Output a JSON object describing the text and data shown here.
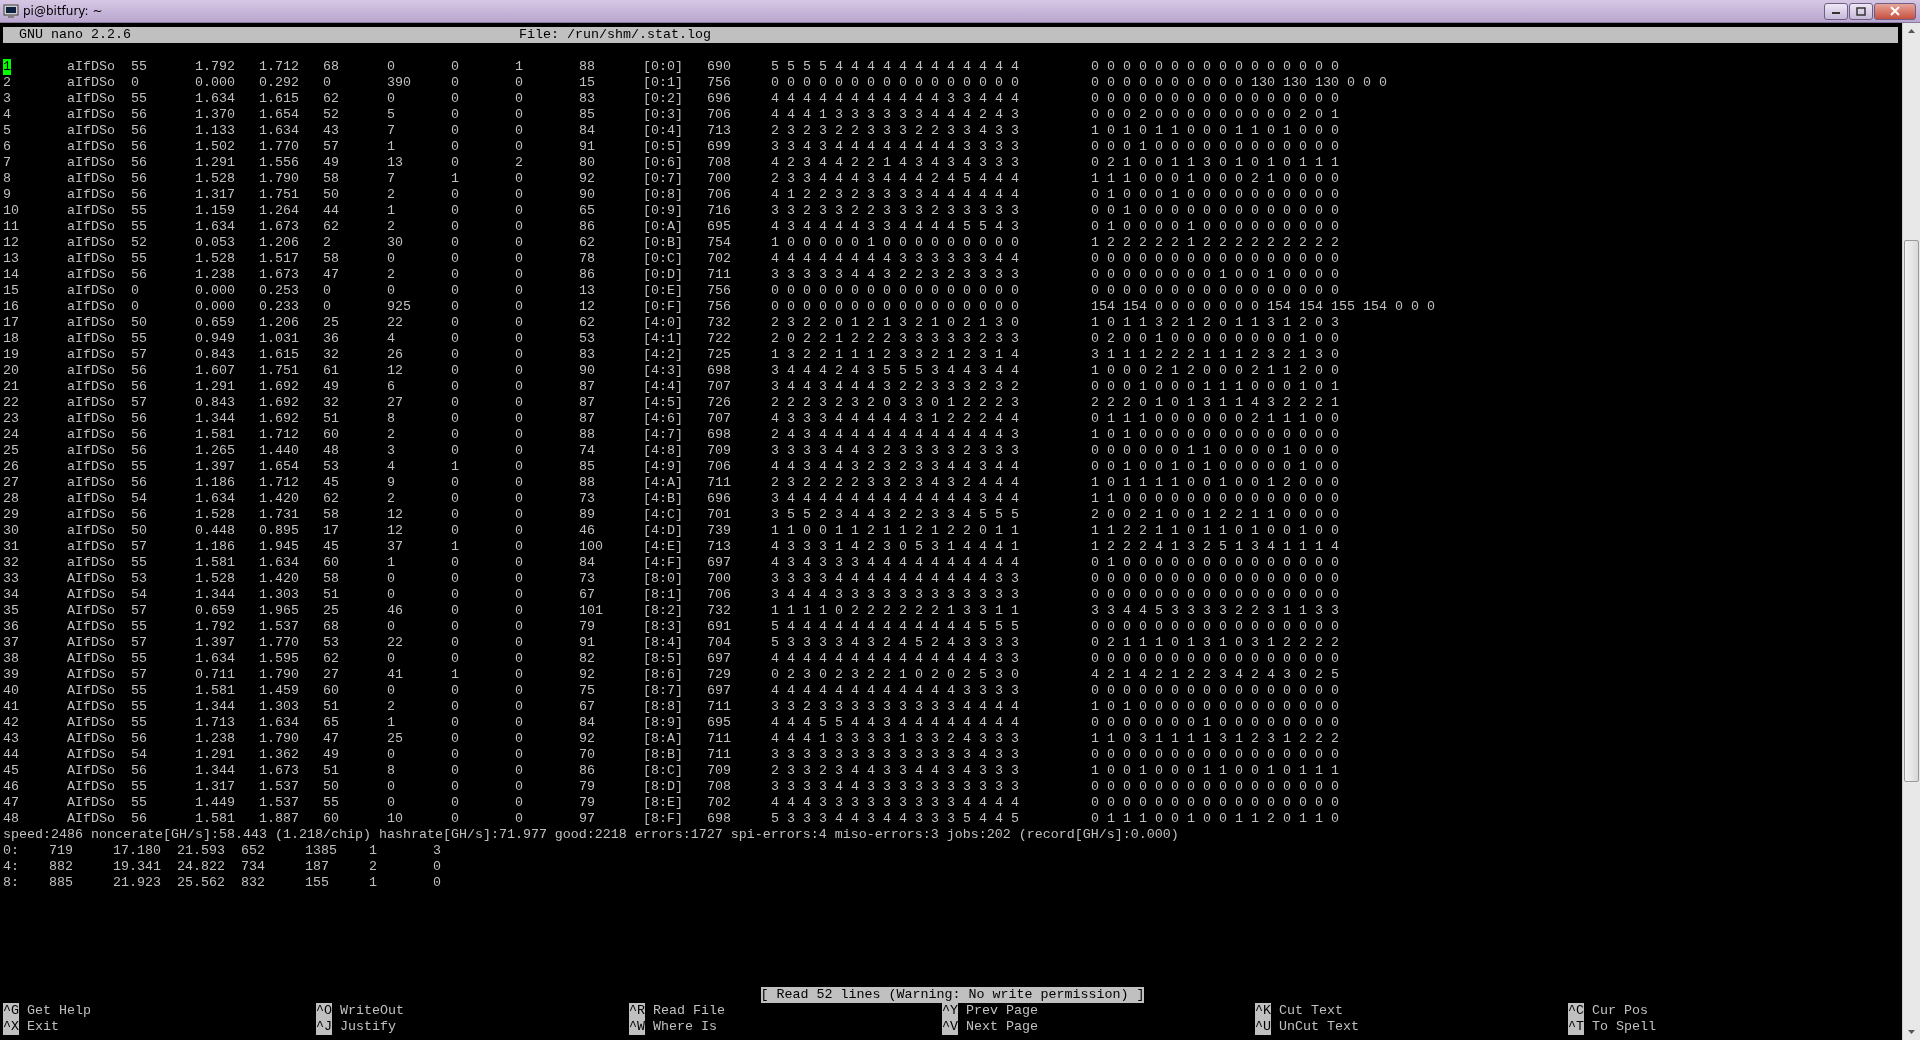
{
  "window": {
    "title": "pi@bitfury: ~"
  },
  "editor_header": {
    "app": "GNU nano 2.2.6",
    "file": "File: /run/shm/.stat.log"
  },
  "cursor_visible": true,
  "rows": [
    [
      "1",
      "aIfDSo",
      "55",
      "1.792",
      "1.712",
      "68",
      "0",
      "0",
      "1",
      "88",
      "[0:0]",
      "690",
      "5 5 5 5 4 4 4 4 4 4 4 4 4 4 4 4",
      "0 0 0 0 0 0 0 0 0 0 0 0 0 0 0 0"
    ],
    [
      "2",
      "aIfDSo",
      "0",
      "0.000",
      "0.292",
      "0",
      "390",
      "0",
      "0",
      "15",
      "[0:1]",
      "756",
      "0 0 0 0 0 0 0 0 0 0 0 0 0 0 0 0",
      "0 0 0 0 0 0 0 0 0 0 130 130 130 0 0 0"
    ],
    [
      "3",
      "aIfDSo",
      "55",
      "1.634",
      "1.615",
      "62",
      "0",
      "0",
      "0",
      "83",
      "[0:2]",
      "696",
      "4 4 4 4 4 4 4 4 4 4 4 3 3 4 4 4",
      "0 0 0 0 0 0 0 0 0 0 0 0 0 0 0 0"
    ],
    [
      "4",
      "aIfDSo",
      "56",
      "1.370",
      "1.654",
      "52",
      "5",
      "0",
      "0",
      "85",
      "[0:3]",
      "706",
      "4 4 4 1 3 3 3 3 3 3 4 4 4 2 4 3",
      "0 0 0 2 0 0 0 0 0 0 0 0 0 2 0 1"
    ],
    [
      "5",
      "aIfDSo",
      "56",
      "1.133",
      "1.634",
      "43",
      "7",
      "0",
      "0",
      "84",
      "[0:4]",
      "713",
      "2 3 2 3 2 2 3 3 3 2 2 3 3 4 3 3",
      "1 0 1 0 1 1 0 0 0 1 1 0 1 0 0 0"
    ],
    [
      "6",
      "aIfDSo",
      "56",
      "1.502",
      "1.770",
      "57",
      "1",
      "0",
      "0",
      "91",
      "[0:5]",
      "699",
      "3 3 4 3 4 4 4 4 4 4 4 4 3 3 3 3",
      "0 0 0 1 0 0 0 0 0 0 0 0 0 0 0 0"
    ],
    [
      "7",
      "aIfDSo",
      "56",
      "1.291",
      "1.556",
      "49",
      "13",
      "0",
      "2",
      "80",
      "[0:6]",
      "708",
      "4 2 3 4 4 2 2 1 4 3 4 3 4 3 3 3",
      "0 2 1 0 0 1 1 3 0 1 0 1 0 1 1 1"
    ],
    [
      "8",
      "aIfDSo",
      "56",
      "1.528",
      "1.790",
      "58",
      "7",
      "1",
      "0",
      "92",
      "[0:7]",
      "700",
      "2 3 3 4 4 4 3 4 4 4 2 4 5 4 4 4",
      "1 1 1 0 0 0 1 0 0 0 2 1 0 0 0 0"
    ],
    [
      "9",
      "aIfDSo",
      "56",
      "1.317",
      "1.751",
      "50",
      "2",
      "0",
      "0",
      "90",
      "[0:8]",
      "706",
      "4 1 2 2 3 2 3 3 3 3 4 4 4 4 4 4",
      "0 1 0 0 0 1 0 0 0 0 0 0 0 0 0 0"
    ],
    [
      "10",
      "aIfDSo",
      "55",
      "1.159",
      "1.264",
      "44",
      "1",
      "0",
      "0",
      "65",
      "[0:9]",
      "716",
      "3 3 2 3 3 2 2 3 3 3 2 3 3 3 3 3",
      "0 0 1 0 0 0 0 0 0 0 0 0 0 0 0 0"
    ],
    [
      "11",
      "aIfDSo",
      "55",
      "1.634",
      "1.673",
      "62",
      "2",
      "0",
      "0",
      "86",
      "[0:A]",
      "695",
      "4 3 4 4 4 4 3 3 4 4 4 4 5 5 4 3",
      "0 1 0 0 0 0 1 0 0 0 0 0 0 0 0 0"
    ],
    [
      "12",
      "aIfDSo",
      "52",
      "0.053",
      "1.206",
      "2",
      "30",
      "0",
      "0",
      "62",
      "[0:B]",
      "754",
      "1 0 0 0 0 0 1 0 0 0 0 0 0 0 0 0",
      "1 2 2 2 2 2 1 2 2 2 2 2 2 2 2 2"
    ],
    [
      "13",
      "aIfDSo",
      "55",
      "1.528",
      "1.517",
      "58",
      "0",
      "0",
      "0",
      "78",
      "[0:C]",
      "702",
      "4 4 4 4 4 4 4 4 3 3 3 3 3 3 4 4",
      "0 0 0 0 0 0 0 0 0 0 0 0 0 0 0 0"
    ],
    [
      "14",
      "aIfDSo",
      "56",
      "1.238",
      "1.673",
      "47",
      "2",
      "0",
      "0",
      "86",
      "[0:D]",
      "711",
      "3 3 3 3 3 4 4 3 2 2 3 2 3 3 3 3",
      "0 0 0 0 0 0 0 0 1 0 0 1 0 0 0 0"
    ],
    [
      "15",
      "aIfDSo",
      "0",
      "0.000",
      "0.253",
      "0",
      "0",
      "0",
      "0",
      "13",
      "[0:E]",
      "756",
      "0 0 0 0 0 0 0 0 0 0 0 0 0 0 0 0",
      "0 0 0 0 0 0 0 0 0 0 0 0 0 0 0 0"
    ],
    [
      "16",
      "aIfDSo",
      "0",
      "0.000",
      "0.233",
      "0",
      "925",
      "0",
      "0",
      "12",
      "[0:F]",
      "756",
      "0 0 0 0 0 0 0 0 0 0 0 0 0 0 0 0",
      "154 154 0 0 0 0 0 0 0 154 154 155 154 0 0 0"
    ],
    [
      "17",
      "aIfDSo",
      "50",
      "0.659",
      "1.206",
      "25",
      "22",
      "0",
      "0",
      "62",
      "[4:0]",
      "732",
      "2 3 2 2 0 1 2 1 3 2 1 0 2 1 3 0",
      "1 0 1 1 3 2 1 2 0 1 1 3 1 2 0 3"
    ],
    [
      "18",
      "aIfDSo",
      "55",
      "0.949",
      "1.031",
      "36",
      "4",
      "0",
      "0",
      "53",
      "[4:1]",
      "722",
      "2 0 2 2 1 2 2 2 3 3 3 3 3 2 3 3",
      "0 2 0 0 1 0 0 0 0 0 0 0 0 1 0 0"
    ],
    [
      "19",
      "aIfDSo",
      "57",
      "0.843",
      "1.615",
      "32",
      "26",
      "0",
      "0",
      "83",
      "[4:2]",
      "725",
      "1 3 2 2 1 1 1 2 3 3 2 1 2 3 1 4",
      "3 1 1 1 2 2 2 1 1 1 2 3 2 1 3 0"
    ],
    [
      "20",
      "aIfDSo",
      "56",
      "1.607",
      "1.751",
      "61",
      "12",
      "0",
      "0",
      "90",
      "[4:3]",
      "698",
      "3 4 4 4 2 4 3 5 5 5 3 4 4 3 4 4",
      "1 0 0 0 2 1 2 0 0 0 2 1 1 2 0 0"
    ],
    [
      "21",
      "aIfDSo",
      "56",
      "1.291",
      "1.692",
      "49",
      "6",
      "0",
      "0",
      "87",
      "[4:4]",
      "707",
      "3 4 4 3 4 4 4 3 2 2 3 3 3 2 3 2",
      "0 0 0 1 0 0 0 1 1 1 0 0 0 1 0 1"
    ],
    [
      "22",
      "aIfDSo",
      "57",
      "0.843",
      "1.692",
      "32",
      "27",
      "0",
      "0",
      "87",
      "[4:5]",
      "726",
      "2 2 2 3 2 3 2 0 3 3 0 1 2 2 2 3",
      "2 2 2 0 1 0 1 3 1 1 4 3 2 2 2 1"
    ],
    [
      "23",
      "aIfDSo",
      "56",
      "1.344",
      "1.692",
      "51",
      "8",
      "0",
      "0",
      "87",
      "[4:6]",
      "707",
      "4 3 3 3 4 4 4 4 4 3 1 2 2 2 4 4",
      "0 1 1 1 0 0 0 0 0 0 2 1 1 1 0 0"
    ],
    [
      "24",
      "aIfDSo",
      "56",
      "1.581",
      "1.712",
      "60",
      "2",
      "0",
      "0",
      "88",
      "[4:7]",
      "698",
      "2 4 3 4 4 4 4 4 4 4 4 4 4 4 4 3",
      "1 0 1 0 0 0 0 0 0 0 0 0 0 0 0 0"
    ],
    [
      "25",
      "aIfDSo",
      "56",
      "1.265",
      "1.440",
      "48",
      "3",
      "0",
      "0",
      "74",
      "[4:8]",
      "709",
      "3 3 3 3 4 4 3 2 3 3 3 3 2 3 3 3",
      "0 0 0 0 0 0 1 1 0 0 0 0 1 0 0 0"
    ],
    [
      "26",
      "aIfDSo",
      "55",
      "1.397",
      "1.654",
      "53",
      "4",
      "1",
      "0",
      "85",
      "[4:9]",
      "706",
      "4 4 3 4 4 3 2 3 2 3 3 4 4 3 4 4",
      "0 0 1 0 0 1 0 1 0 0 0 0 0 1 0 0"
    ],
    [
      "27",
      "aIfDSo",
      "56",
      "1.186",
      "1.712",
      "45",
      "9",
      "0",
      "0",
      "88",
      "[4:A]",
      "711",
      "2 3 2 2 2 2 3 3 2 3 4 3 2 4 4 4",
      "1 0 1 1 1 1 0 0 1 0 0 1 2 0 0 0"
    ],
    [
      "28",
      "aIfDSo",
      "54",
      "1.634",
      "1.420",
      "62",
      "2",
      "0",
      "0",
      "73",
      "[4:B]",
      "696",
      "3 4 4 4 4 4 4 4 4 4 4 4 4 3 4 4",
      "1 1 0 0 0 0 0 0 0 0 0 0 0 0 0 0"
    ],
    [
      "29",
      "aIfDSo",
      "56",
      "1.528",
      "1.731",
      "58",
      "12",
      "0",
      "0",
      "89",
      "[4:C]",
      "701",
      "3 5 5 2 3 4 4 3 2 2 3 3 4 5 5 5",
      "2 0 0 2 1 0 0 1 2 2 1 1 0 0 0 0"
    ],
    [
      "30",
      "aIfDSo",
      "50",
      "0.448",
      "0.895",
      "17",
      "12",
      "0",
      "0",
      "46",
      "[4:D]",
      "739",
      "1 1 0 0 1 1 2 1 1 2 1 2 2 0 1 1",
      "1 1 2 2 1 1 0 1 1 0 1 0 0 1 0 0"
    ],
    [
      "31",
      "aIfDSo",
      "57",
      "1.186",
      "1.945",
      "45",
      "37",
      "1",
      "0",
      "100",
      "[4:E]",
      "713",
      "4 3 3 3 1 4 2 3 0 5 3 1 4 4 4 1",
      "1 2 2 2 4 1 3 2 5 1 3 4 1 1 1 4"
    ],
    [
      "32",
      "aIfDSo",
      "55",
      "1.581",
      "1.634",
      "60",
      "1",
      "0",
      "0",
      "84",
      "[4:F]",
      "697",
      "4 3 4 3 3 3 4 4 4 4 4 4 4 4 4 4",
      "0 1 0 0 0 0 0 0 0 0 0 0 0 0 0 0"
    ],
    [
      "33",
      "AIfDSo",
      "53",
      "1.528",
      "1.420",
      "58",
      "0",
      "0",
      "0",
      "73",
      "[8:0]",
      "700",
      "3 3 3 3 4 4 4 4 4 4 4 4 4 4 3 3",
      "0 0 0 0 0 0 0 0 0 0 0 0 0 0 0 0"
    ],
    [
      "34",
      "AIfDSo",
      "54",
      "1.344",
      "1.303",
      "51",
      "0",
      "0",
      "0",
      "67",
      "[8:1]",
      "706",
      "3 4 4 4 3 3 3 3 3 3 3 3 3 3 3 3",
      "0 0 0 0 0 0 0 0 0 0 0 0 0 0 0 0"
    ],
    [
      "35",
      "AIfDSo",
      "57",
      "0.659",
      "1.965",
      "25",
      "46",
      "0",
      "0",
      "101",
      "[8:2]",
      "732",
      "1 1 1 1 0 2 2 2 2 2 2 1 3 3 1 1",
      "3 3 4 4 5 3 3 3 3 2 2 3 1 1 3 3"
    ],
    [
      "36",
      "AIfDSo",
      "55",
      "1.792",
      "1.537",
      "68",
      "0",
      "0",
      "0",
      "79",
      "[8:3]",
      "691",
      "5 4 4 4 4 4 4 4 4 4 4 4 4 5 5 5",
      "0 0 0 0 0 0 0 0 0 0 0 0 0 0 0 0"
    ],
    [
      "37",
      "AIfDSo",
      "57",
      "1.397",
      "1.770",
      "53",
      "22",
      "0",
      "0",
      "91",
      "[8:4]",
      "704",
      "5 3 3 3 3 4 3 2 4 5 2 4 3 3 3 3",
      "0 2 1 1 1 0 1 3 1 0 3 1 2 2 2 2"
    ],
    [
      "38",
      "AIfDSo",
      "55",
      "1.634",
      "1.595",
      "62",
      "0",
      "0",
      "0",
      "82",
      "[8:5]",
      "697",
      "4 4 4 4 4 4 4 4 4 4 4 4 4 4 3 3",
      "0 0 0 0 0 0 0 0 0 0 0 0 0 0 0 0"
    ],
    [
      "39",
      "AIfDSo",
      "57",
      "0.711",
      "1.790",
      "27",
      "41",
      "1",
      "0",
      "92",
      "[8:6]",
      "729",
      "0 2 3 0 2 3 2 2 1 0 2 0 2 5 3 0",
      "4 2 1 4 2 1 2 2 3 4 2 4 3 0 2 5"
    ],
    [
      "40",
      "AIfDSo",
      "55",
      "1.581",
      "1.459",
      "60",
      "0",
      "0",
      "0",
      "75",
      "[8:7]",
      "697",
      "4 4 4 4 4 4 4 4 4 4 4 4 3 3 3 3",
      "0 0 0 0 0 0 0 0 0 0 0 0 0 0 0 0"
    ],
    [
      "41",
      "AIfDSo",
      "55",
      "1.344",
      "1.303",
      "51",
      "2",
      "0",
      "0",
      "67",
      "[8:8]",
      "711",
      "3 3 2 3 3 3 3 3 3 3 3 3 4 4 4 4",
      "1 0 1 0 0 0 0 0 0 0 0 0 0 0 0 0"
    ],
    [
      "42",
      "AIfDSo",
      "55",
      "1.713",
      "1.634",
      "65",
      "1",
      "0",
      "0",
      "84",
      "[8:9]",
      "695",
      "4 4 4 5 5 4 4 3 4 4 4 4 4 4 4 4",
      "0 0 0 0 0 0 0 1 0 0 0 0 0 0 0 0"
    ],
    [
      "43",
      "AIfDSo",
      "56",
      "1.238",
      "1.790",
      "47",
      "25",
      "0",
      "0",
      "92",
      "[8:A]",
      "711",
      "4 4 4 1 3 3 3 3 1 3 3 2 4 3 3 3",
      "1 1 0 3 1 1 1 1 3 1 2 3 1 2 2 2"
    ],
    [
      "44",
      "AIfDSo",
      "54",
      "1.291",
      "1.362",
      "49",
      "0",
      "0",
      "0",
      "70",
      "[8:B]",
      "711",
      "3 3 3 3 3 3 3 3 3 3 3 3 3 4 3 3",
      "0 0 0 0 0 0 0 0 0 0 0 0 0 0 0 0"
    ],
    [
      "45",
      "AIfDSo",
      "56",
      "1.344",
      "1.673",
      "51",
      "8",
      "0",
      "0",
      "86",
      "[8:C]",
      "709",
      "2 3 3 2 3 4 4 3 3 4 4 3 4 3 3 3",
      "1 0 0 1 0 0 0 1 1 0 0 1 0 1 1 1"
    ],
    [
      "46",
      "AIfDSo",
      "55",
      "1.317",
      "1.537",
      "50",
      "0",
      "0",
      "0",
      "79",
      "[8:D]",
      "708",
      "3 3 3 3 4 4 3 3 3 3 3 3 3 3 3 3",
      "0 0 0 0 0 0 0 0 0 0 0 0 0 0 0 0"
    ],
    [
      "47",
      "AIfDSo",
      "55",
      "1.449",
      "1.537",
      "55",
      "0",
      "0",
      "0",
      "79",
      "[8:E]",
      "702",
      "4 4 4 3 3 3 3 3 3 3 3 3 4 4 4 4",
      "0 0 0 0 0 0 0 0 0 0 0 0 0 0 0 0"
    ],
    [
      "48",
      "AIfDSo",
      "56",
      "1.581",
      "1.887",
      "60",
      "10",
      "0",
      "0",
      "97",
      "[8:F]",
      "698",
      "5 3 3 3 4 4 3 4 4 3 3 3 5 4 4 5",
      "0 1 1 1 0 0 1 0 0 1 1 2 0 1 1 0"
    ]
  ],
  "speed_line": "speed:2486 noncerate[GH/s]:58.443 (1.218/chip) hashrate[GH/s]:71.977 good:2218 errors:1727 spi-errors:4 miso-errors:3 jobs:202 (record[GH/s]:0.000)",
  "summary_rows": [
    [
      "0:",
      "719",
      "17.180",
      "21.593",
      "652",
      "1385",
      "1",
      "3"
    ],
    [
      "4:",
      "882",
      "19.341",
      "24.822",
      "734",
      "187",
      "2",
      "0"
    ],
    [
      "8:",
      "885",
      "21.923",
      "25.562",
      "832",
      "155",
      "1",
      "0"
    ]
  ],
  "status_message": "[ Read 52 lines (Warning: No write permission) ]",
  "shortcuts": [
    [
      {
        "key": "^G",
        "label": "Get Help"
      },
      {
        "key": "^O",
        "label": "WriteOut"
      },
      {
        "key": "^R",
        "label": "Read File"
      },
      {
        "key": "^Y",
        "label": "Prev Page"
      },
      {
        "key": "^K",
        "label": "Cut Text"
      },
      {
        "key": "^C",
        "label": "Cur Pos"
      }
    ],
    [
      {
        "key": "^X",
        "label": "Exit"
      },
      {
        "key": "^J",
        "label": "Justify"
      },
      {
        "key": "^W",
        "label": "Where Is"
      },
      {
        "key": "^V",
        "label": "Next Page"
      },
      {
        "key": "^U",
        "label": "UnCut Text"
      },
      {
        "key": "^T",
        "label": "To Spell"
      }
    ]
  ]
}
